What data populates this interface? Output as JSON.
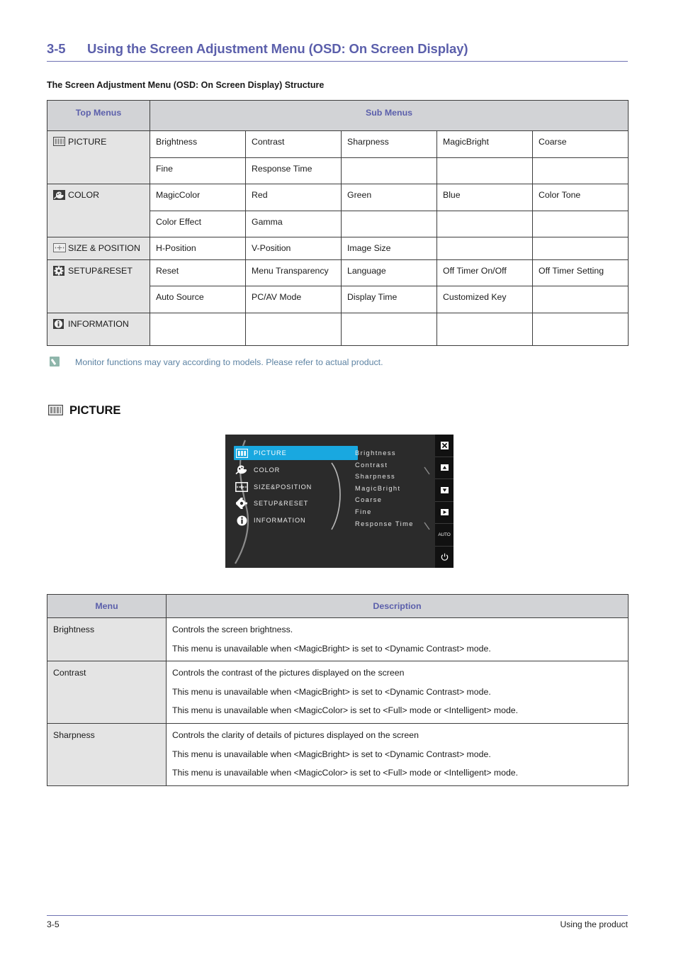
{
  "section": {
    "number": "3-5",
    "title": "Using the Screen Adjustment Menu (OSD: On Screen Display)",
    "subheading": "The Screen Adjustment Menu (OSD: On Screen Display) Structure"
  },
  "structure_table": {
    "headers": {
      "left": "Top Menus",
      "right": "Sub Menus"
    },
    "groups": [
      {
        "icon": "picture-icon",
        "label": "PICTURE",
        "rows": [
          [
            "Brightness",
            "Contrast",
            "Sharpness",
            "MagicBright",
            "Coarse"
          ],
          [
            "Fine",
            "Response Time",
            "",
            "",
            ""
          ]
        ]
      },
      {
        "icon": "color-icon",
        "label": "COLOR",
        "rows": [
          [
            "MagicColor",
            "Red",
            "Green",
            "Blue",
            "Color Tone"
          ],
          [
            "Color Effect",
            "Gamma",
            "",
            "",
            ""
          ]
        ]
      },
      {
        "icon": "size-position-icon",
        "label": "SIZE & POSITION",
        "rows": [
          [
            "H-Position",
            "V-Position",
            "Image Size",
            "",
            ""
          ]
        ]
      },
      {
        "icon": "setup-reset-icon",
        "label": "SETUP&RESET",
        "rows": [
          [
            "Reset",
            "Menu Transparency",
            "Language",
            "Off Timer On/Off",
            "Off Timer Setting"
          ],
          [
            "Auto Source",
            "PC/AV Mode",
            "Display Time",
            "Customized Key",
            ""
          ]
        ]
      },
      {
        "icon": "information-icon",
        "label": "INFORMATION",
        "rows": [
          [
            "",
            "",
            "",
            "",
            ""
          ]
        ]
      }
    ]
  },
  "note": {
    "icon": "note-pencil-icon",
    "text": "Monitor functions may vary according to models. Please refer to actual product.",
    "color": "#5d83a3"
  },
  "picture_heading": {
    "icon": "picture-icon",
    "label": "PICTURE"
  },
  "osd": {
    "selected_menu": "PICTURE",
    "highlight_color": "#19a8e0",
    "background": "#2b2b2b",
    "menus": [
      {
        "icon": "picture-icon",
        "label": "PICTURE",
        "selected": true
      },
      {
        "icon": "color-icon",
        "label": "COLOR",
        "selected": false
      },
      {
        "icon": "size-position-icon",
        "label": "SIZE&POSITION",
        "selected": false
      },
      {
        "icon": "setup-reset-icon",
        "label": "SETUP&RESET",
        "selected": false
      },
      {
        "icon": "information-icon",
        "label": "INFORMATION",
        "selected": false
      }
    ],
    "submenus": [
      "Brightness",
      "Contrast",
      "Sharpness",
      "MagicBright",
      "Coarse",
      "Fine",
      "Response Time"
    ],
    "buttons": [
      {
        "icon": "close-icon",
        "label": "✖"
      },
      {
        "icon": "up-arrow-icon",
        "label": "▲"
      },
      {
        "icon": "down-arrow-icon",
        "label": "▼"
      },
      {
        "icon": "right-arrow-icon",
        "label": "▶"
      },
      {
        "icon": "auto-button",
        "label": "AUTO"
      },
      {
        "icon": "power-icon",
        "label": "⏻"
      }
    ]
  },
  "description_table": {
    "headers": {
      "menu": "Menu",
      "description": "Description"
    },
    "rows": [
      {
        "menu": "Brightness",
        "lines": [
          "Controls the screen brightness.",
          "This menu is unavailable when <MagicBright> is set to <Dynamic Contrast> mode."
        ]
      },
      {
        "menu": "Contrast",
        "lines": [
          "Controls the contrast of the pictures displayed on the screen",
          "This menu is unavailable when <MagicBright> is set to <Dynamic Contrast> mode.",
          "This menu is unavailable when <MagicColor> is set to <Full> mode or <Intelligent> mode."
        ]
      },
      {
        "menu": "Sharpness",
        "lines": [
          "Controls the clarity of details of pictures displayed on the screen",
          "This menu is unavailable when <MagicBright> is set to <Dynamic Contrast> mode.",
          "This menu is unavailable when <MagicColor> is set to <Full> mode or <Intelligent> mode."
        ]
      }
    ]
  },
  "footer": {
    "page": "3-5",
    "chapter": "Using the product"
  }
}
